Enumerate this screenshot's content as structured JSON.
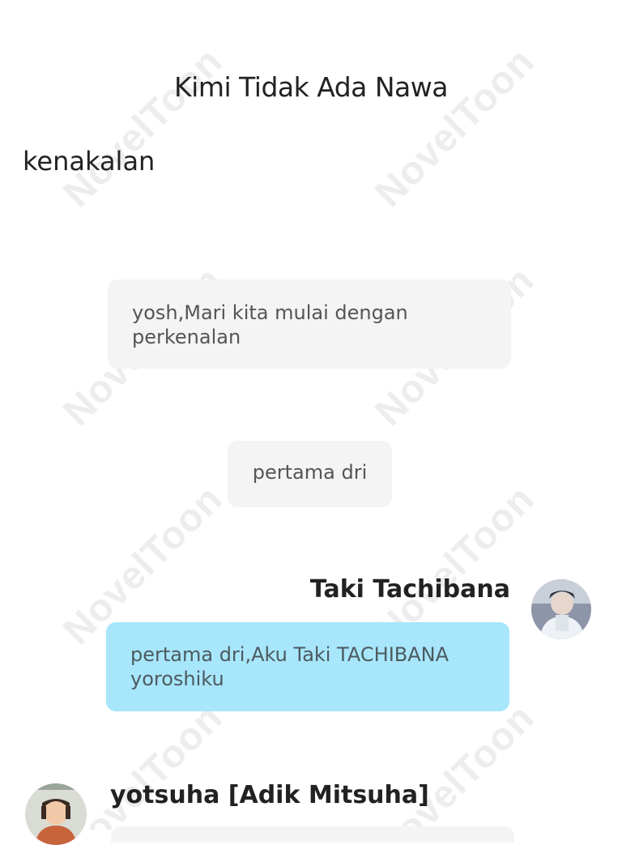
{
  "header": {
    "title": "Kimi Tidak Ada Nawa"
  },
  "section": {
    "heading": "kenakalan"
  },
  "messages": {
    "narration1": "yosh,Mari kita mulai dengan perkenalan",
    "narration2": "pertama dri",
    "taki": {
      "name": "Taki Tachibana",
      "text": "pertama dri,Aku Taki TACHIBANA yoroshiku",
      "avatar_icon": "character-avatar"
    },
    "yotsuha": {
      "name": "yotsuha [Adik Mitsuha]",
      "avatar_icon": "character-avatar"
    }
  },
  "watermark": {
    "text": "NovelToon"
  },
  "colors": {
    "background": "#ffffff",
    "narration_bubble": "#f4f4f4",
    "speaker_bubble": "#a7e6fb",
    "title_text": "#222222",
    "bubble_text": "#555555",
    "watermark": "#ededed"
  }
}
